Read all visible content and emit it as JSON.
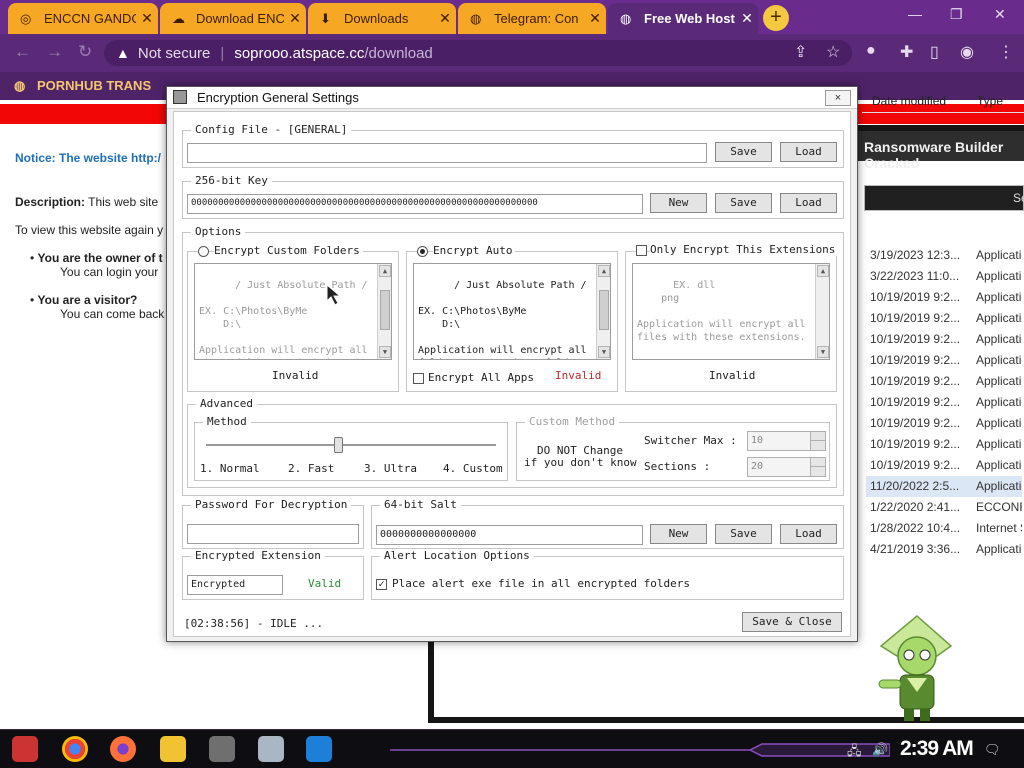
{
  "browser": {
    "tabs": [
      {
        "label": "ENCCN GANDC",
        "icon": "ring-icon"
      },
      {
        "label": "Download ENC",
        "icon": "cloud-icon"
      },
      {
        "label": "Downloads",
        "icon": "download-icon"
      },
      {
        "label": "Telegram: Con",
        "icon": "globe-icon"
      },
      {
        "label": "Free Web Host",
        "icon": "globe-icon"
      }
    ],
    "address": {
      "security": "Not secure",
      "host": "soprooo.atspace.cc",
      "path": "/download"
    },
    "bookmarks": [
      "PORNHUB TRANS"
    ]
  },
  "webpage": {
    "notice": "Notice: The website http:/",
    "description_label": "Description:",
    "description_text": "This web site",
    "view_again": "To view this website again y",
    "owner_bold": "You are the owner of t",
    "owner_sub": "You can login your",
    "visitor_bold": "You are a visitor?",
    "visitor_sub": "You can come back"
  },
  "explorer": {
    "title": "Ransomware Builder Cracked",
    "search_placeholder": "Se",
    "columns": {
      "date": "Date modified",
      "type": "Type"
    },
    "rows": [
      {
        "date": "3/19/2023 12:3...",
        "type": "Application"
      },
      {
        "date": "3/22/2023 11:0...",
        "type": "Application"
      },
      {
        "date": "10/19/2019 9:2...",
        "type": "Application"
      },
      {
        "date": "10/19/2019 9:2...",
        "type": "Application"
      },
      {
        "date": "10/19/2019 9:2...",
        "type": "Application"
      },
      {
        "date": "10/19/2019 9:2...",
        "type": "Application"
      },
      {
        "date": "10/19/2019 9:2...",
        "type": "Application"
      },
      {
        "date": "10/19/2019 9:2...",
        "type": "Application"
      },
      {
        "date": "10/19/2019 9:2...",
        "type": "Application"
      },
      {
        "date": "10/19/2019 9:2...",
        "type": "Application"
      },
      {
        "date": "10/19/2019 9:2...",
        "type": "Application"
      },
      {
        "date": "11/20/2022 2:5...",
        "type": "Application"
      },
      {
        "date": "1/22/2020 2:41...",
        "type": "ECCONFIG"
      },
      {
        "date": "1/28/2022 10:4...",
        "type": "Internet S"
      },
      {
        "date": "4/21/2019 3:36...",
        "type": "Application"
      }
    ]
  },
  "dialog": {
    "title": "Encryption General Settings",
    "close": "×",
    "config": {
      "title": "Config File - [GENERAL]",
      "value": "",
      "save": "Save",
      "load": "Load"
    },
    "key": {
      "title": "256-bit Key",
      "value": "0000000000000000000000000000000000000000000000000000000000000000",
      "new": "New",
      "save": "Save",
      "load": "Load"
    },
    "options": {
      "title": "Options",
      "custom_folders": {
        "label": "Encrypt Custom Folders",
        "text": "/ Just Absolute Path /\n\nEX. C:\\Photos\\ByMe\n    D:\\\n\nApplication will encrypt all\nthese folders and thair sub",
        "status": "Invalid"
      },
      "auto": {
        "label": "Encrypt Auto",
        "text": "/ Just Absolute Path /\n\nEX. C:\\Photos\\ByMe\n    D:\\\n\nApplication will encrypt all\nfolders except these folders",
        "all_apps": "Encrypt All Apps",
        "status": "Invalid"
      },
      "extensions": {
        "label": "Only Encrypt This Extensions",
        "text": "EX. dll\n    png\n\nApplication will encrypt all\nfiles with these extensions.",
        "status": "Invalid"
      }
    },
    "advanced": {
      "title": "Advanced",
      "method_title": "Method",
      "method_levels": [
        "1. Normal",
        "2. Fast",
        "3. Ultra",
        "4. Custom"
      ],
      "method_selected": 3,
      "custom_title": "Custom Method",
      "warning": "DO NOT Change\nif you don't know",
      "switcher_label": "Switcher Max :",
      "switcher_value": "10",
      "sections_label": "Sections :",
      "sections_value": "20"
    },
    "password": {
      "title": "Password For Decryption",
      "value": ""
    },
    "salt": {
      "title": "64-bit Salt",
      "value": "0000000000000000",
      "new": "New",
      "save": "Save",
      "load": "Load"
    },
    "extension": {
      "title": "Encrypted Extension",
      "value": "Encrypted",
      "status": "Valid"
    },
    "alert": {
      "title": "Alert Location Options",
      "option": "Place alert exe file in all encrypted folders"
    },
    "status": "[02:38:56] - IDLE ...",
    "save_close": "Save & Close"
  },
  "taskbar": {
    "clock": "2:39 AM"
  },
  "colors": {
    "tab_orange": "#f6a723",
    "chrome_purple": "#5a2a78",
    "alert_red": "#f20606",
    "invalid": "#c0282d",
    "valid": "#2e8b3a"
  }
}
